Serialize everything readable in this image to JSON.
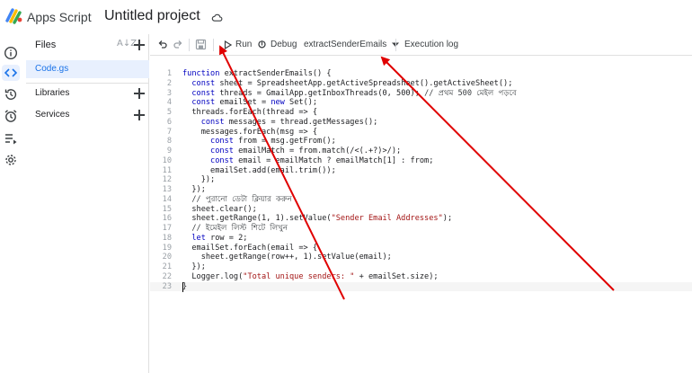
{
  "app": {
    "name": "Apps Script",
    "project_title": "Untitled project"
  },
  "files_panel": {
    "title": "Files",
    "files": [
      {
        "name": "Code.gs"
      }
    ],
    "libraries_label": "Libraries",
    "services_label": "Services"
  },
  "toolbar": {
    "run_label": "Run",
    "debug_label": "Debug",
    "function_name": "extractSenderEmails",
    "execution_log_label": "Execution log"
  },
  "editor": {
    "lines": [
      "function extractSenderEmails() {",
      "  const sheet = SpreadsheetApp.getActiveSpreadsheet().getActiveSheet();",
      "  const threads = GmailApp.getInboxThreads(0, 500); // প্রথম 500 মেইল পড়বে",
      "  const emailSet = new Set();",
      "  threads.forEach(thread => {",
      "    const messages = thread.getMessages();",
      "    messages.forEach(msg => {",
      "      const from = msg.getFrom();",
      "      const emailMatch = from.match(/<(.+?)>/);",
      "      const email = emailMatch ? emailMatch[1] : from;",
      "      emailSet.add(email.trim());",
      "    });",
      "  });",
      "  // পুরানো ডেটা ক্লিয়ার করুন",
      "  sheet.clear();",
      "  sheet.getRange(1, 1).setValue(\"Sender Email Addresses\");",
      "  // ইমেইল লিস্ট শিটে লিখুন",
      "  let row = 2;",
      "  emailSet.forEach(email => {",
      "    sheet.getRange(row++, 1).setValue(email);",
      "  });",
      "  Logger.log(\"Total unique senders: \" + emailSet.size);",
      "}"
    ]
  },
  "colors": {
    "accent": "#1a73e8",
    "arrow": "#e00000",
    "selected_file_bg": "#e8f0fe"
  }
}
